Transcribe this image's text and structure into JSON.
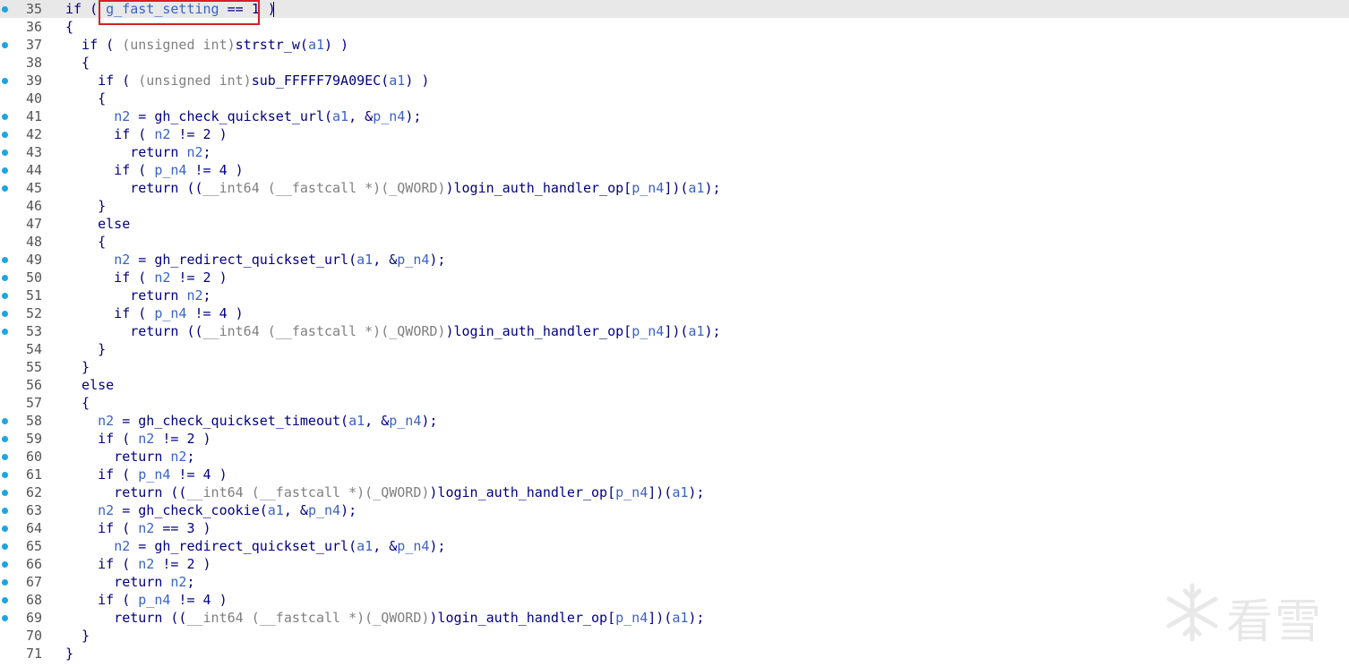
{
  "editor": {
    "first_line": 35,
    "current_line": 35,
    "lines": [
      {
        "n": "35",
        "bp": true,
        "segs": [
          [
            "p",
            "if ( "
          ],
          [
            "v",
            "g_fast_setting"
          ],
          [
            "p",
            " == 1 )"
          ]
        ]
      },
      {
        "n": "36",
        "bp": false,
        "segs": [
          [
            "p",
            "{"
          ]
        ]
      },
      {
        "n": "37",
        "bp": true,
        "segs": [
          [
            "p",
            "  if ( "
          ],
          [
            "g",
            "(unsigned int)"
          ],
          [
            "p",
            "strstr_w("
          ],
          [
            "v",
            "a1"
          ],
          [
            "p",
            ") )"
          ]
        ]
      },
      {
        "n": "38",
        "bp": false,
        "segs": [
          [
            "p",
            "  {"
          ]
        ]
      },
      {
        "n": "39",
        "bp": true,
        "segs": [
          [
            "p",
            "    if ( "
          ],
          [
            "g",
            "(unsigned int)"
          ],
          [
            "p",
            "sub_FFFFF79A09EC("
          ],
          [
            "v",
            "a1"
          ],
          [
            "p",
            ") )"
          ]
        ]
      },
      {
        "n": "40",
        "bp": false,
        "segs": [
          [
            "p",
            "    {"
          ]
        ]
      },
      {
        "n": "41",
        "bp": true,
        "segs": [
          [
            "p",
            "      "
          ],
          [
            "v",
            "n2"
          ],
          [
            "p",
            " = gh_check_quickset_url("
          ],
          [
            "v",
            "a1"
          ],
          [
            "p",
            ", &"
          ],
          [
            "v",
            "p_n4"
          ],
          [
            "p",
            ");"
          ]
        ]
      },
      {
        "n": "42",
        "bp": true,
        "segs": [
          [
            "p",
            "      if ( "
          ],
          [
            "v",
            "n2"
          ],
          [
            "p",
            " != 2 )"
          ]
        ]
      },
      {
        "n": "43",
        "bp": true,
        "segs": [
          [
            "p",
            "        return "
          ],
          [
            "v",
            "n2"
          ],
          [
            "p",
            ";"
          ]
        ]
      },
      {
        "n": "44",
        "bp": true,
        "segs": [
          [
            "p",
            "      if ( "
          ],
          [
            "v",
            "p_n4"
          ],
          [
            "p",
            " != 4 )"
          ]
        ]
      },
      {
        "n": "45",
        "bp": true,
        "segs": [
          [
            "p",
            "        return (("
          ],
          [
            "g",
            "__int64 (__fastcall *)(_QWORD)"
          ],
          [
            "p",
            ")login_auth_handler_op["
          ],
          [
            "v",
            "p_n4"
          ],
          [
            "p",
            "])("
          ],
          [
            "v",
            "a1"
          ],
          [
            "p",
            ");"
          ]
        ]
      },
      {
        "n": "46",
        "bp": false,
        "segs": [
          [
            "p",
            "    }"
          ]
        ]
      },
      {
        "n": "47",
        "bp": false,
        "segs": [
          [
            "p",
            "    else"
          ]
        ]
      },
      {
        "n": "48",
        "bp": false,
        "segs": [
          [
            "p",
            "    {"
          ]
        ]
      },
      {
        "n": "49",
        "bp": true,
        "segs": [
          [
            "p",
            "      "
          ],
          [
            "v",
            "n2"
          ],
          [
            "p",
            " = gh_redirect_quickset_url("
          ],
          [
            "v",
            "a1"
          ],
          [
            "p",
            ", &"
          ],
          [
            "v",
            "p_n4"
          ],
          [
            "p",
            ");"
          ]
        ]
      },
      {
        "n": "50",
        "bp": true,
        "segs": [
          [
            "p",
            "      if ( "
          ],
          [
            "v",
            "n2"
          ],
          [
            "p",
            " != 2 )"
          ]
        ]
      },
      {
        "n": "51",
        "bp": true,
        "segs": [
          [
            "p",
            "        return "
          ],
          [
            "v",
            "n2"
          ],
          [
            "p",
            ";"
          ]
        ]
      },
      {
        "n": "52",
        "bp": true,
        "segs": [
          [
            "p",
            "      if ( "
          ],
          [
            "v",
            "p_n4"
          ],
          [
            "p",
            " != 4 )"
          ]
        ]
      },
      {
        "n": "53",
        "bp": true,
        "segs": [
          [
            "p",
            "        return (("
          ],
          [
            "g",
            "__int64 (__fastcall *)(_QWORD)"
          ],
          [
            "p",
            ")login_auth_handler_op["
          ],
          [
            "v",
            "p_n4"
          ],
          [
            "p",
            "])("
          ],
          [
            "v",
            "a1"
          ],
          [
            "p",
            ");"
          ]
        ]
      },
      {
        "n": "54",
        "bp": false,
        "segs": [
          [
            "p",
            "    }"
          ]
        ]
      },
      {
        "n": "55",
        "bp": false,
        "segs": [
          [
            "p",
            "  }"
          ]
        ]
      },
      {
        "n": "56",
        "bp": false,
        "segs": [
          [
            "p",
            "  else"
          ]
        ]
      },
      {
        "n": "57",
        "bp": false,
        "segs": [
          [
            "p",
            "  {"
          ]
        ]
      },
      {
        "n": "58",
        "bp": true,
        "segs": [
          [
            "p",
            "    "
          ],
          [
            "v",
            "n2"
          ],
          [
            "p",
            " = gh_check_quickset_timeout("
          ],
          [
            "v",
            "a1"
          ],
          [
            "p",
            ", &"
          ],
          [
            "v",
            "p_n4"
          ],
          [
            "p",
            ");"
          ]
        ]
      },
      {
        "n": "59",
        "bp": true,
        "segs": [
          [
            "p",
            "    if ( "
          ],
          [
            "v",
            "n2"
          ],
          [
            "p",
            " != 2 )"
          ]
        ]
      },
      {
        "n": "60",
        "bp": true,
        "segs": [
          [
            "p",
            "      return "
          ],
          [
            "v",
            "n2"
          ],
          [
            "p",
            ";"
          ]
        ]
      },
      {
        "n": "61",
        "bp": true,
        "segs": [
          [
            "p",
            "    if ( "
          ],
          [
            "v",
            "p_n4"
          ],
          [
            "p",
            " != 4 )"
          ]
        ]
      },
      {
        "n": "62",
        "bp": true,
        "segs": [
          [
            "p",
            "      return (("
          ],
          [
            "g",
            "__int64 (__fastcall *)(_QWORD)"
          ],
          [
            "p",
            ")login_auth_handler_op["
          ],
          [
            "v",
            "p_n4"
          ],
          [
            "p",
            "])("
          ],
          [
            "v",
            "a1"
          ],
          [
            "p",
            ");"
          ]
        ]
      },
      {
        "n": "63",
        "bp": true,
        "segs": [
          [
            "p",
            "    "
          ],
          [
            "v",
            "n2"
          ],
          [
            "p",
            " = gh_check_cookie("
          ],
          [
            "v",
            "a1"
          ],
          [
            "p",
            ", &"
          ],
          [
            "v",
            "p_n4"
          ],
          [
            "p",
            ");"
          ]
        ]
      },
      {
        "n": "64",
        "bp": true,
        "segs": [
          [
            "p",
            "    if ( "
          ],
          [
            "v",
            "n2"
          ],
          [
            "p",
            " == 3 )"
          ]
        ]
      },
      {
        "n": "65",
        "bp": true,
        "segs": [
          [
            "p",
            "      "
          ],
          [
            "v",
            "n2"
          ],
          [
            "p",
            " = gh_redirect_quickset_url("
          ],
          [
            "v",
            "a1"
          ],
          [
            "p",
            ", &"
          ],
          [
            "v",
            "p_n4"
          ],
          [
            "p",
            ");"
          ]
        ]
      },
      {
        "n": "66",
        "bp": true,
        "segs": [
          [
            "p",
            "    if ( "
          ],
          [
            "v",
            "n2"
          ],
          [
            "p",
            " != 2 )"
          ]
        ]
      },
      {
        "n": "67",
        "bp": true,
        "segs": [
          [
            "p",
            "      return "
          ],
          [
            "v",
            "n2"
          ],
          [
            "p",
            ";"
          ]
        ]
      },
      {
        "n": "68",
        "bp": true,
        "segs": [
          [
            "p",
            "    if ( "
          ],
          [
            "v",
            "p_n4"
          ],
          [
            "p",
            " != 4 )"
          ]
        ]
      },
      {
        "n": "69",
        "bp": true,
        "segs": [
          [
            "p",
            "      return (("
          ],
          [
            "g",
            "__int64 (__fastcall *)(_QWORD)"
          ],
          [
            "p",
            ")login_auth_handler_op["
          ],
          [
            "v",
            "p_n4"
          ],
          [
            "p",
            "])("
          ],
          [
            "v",
            "a1"
          ],
          [
            "p",
            ");"
          ]
        ]
      },
      {
        "n": "70",
        "bp": false,
        "segs": [
          [
            "p",
            "  }"
          ]
        ]
      },
      {
        "n": "71",
        "bp": false,
        "segs": [
          [
            "p",
            "}"
          ]
        ]
      }
    ]
  },
  "watermark": {
    "text": "看雪",
    "icon": "snowflake-icon"
  },
  "colors": {
    "keyword": "#000080",
    "variable": "#3a62c4",
    "cast_gray": "#808080",
    "breakpoint_dot": "#1aa6e4",
    "current_line_bg": "#e8e8e8",
    "highlight_box": "#d61f26"
  }
}
